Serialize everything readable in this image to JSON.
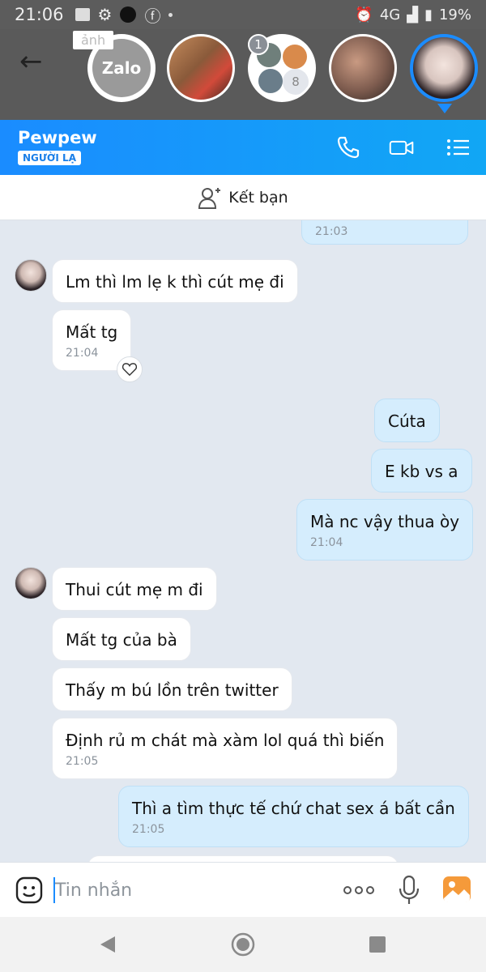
{
  "status_bar": {
    "time": "21:06",
    "network": "4G",
    "battery": "19%"
  },
  "chat_heads": {
    "zalo_label": "Zalo",
    "obscured_label": "ảnh",
    "group_badge": "1",
    "group_member_count": "8"
  },
  "header": {
    "contact_name": "Pewpew",
    "stranger_badge": "NGƯỜI LẠ"
  },
  "add_friend": {
    "label": "Kết bạn"
  },
  "messages": [
    {
      "side": "out",
      "text": "",
      "time": "21:03"
    },
    {
      "side": "in",
      "text": "Lm thì lm lẹ k thì cút mẹ đi",
      "time": ""
    },
    {
      "side": "in",
      "text": "Mất tg",
      "time": "21:04"
    },
    {
      "side": "out",
      "text": "Cúta",
      "time": ""
    },
    {
      "side": "out",
      "text": "E kb vs a",
      "time": ""
    },
    {
      "side": "out",
      "text": "Mà nc vậy thua òy",
      "time": "21:04"
    },
    {
      "side": "in",
      "text": "Thui cút mẹ m đi",
      "time": ""
    },
    {
      "side": "in",
      "text": "Mất tg của bà",
      "time": ""
    },
    {
      "side": "in",
      "text": "Thấy m bú lồn trên twitter",
      "time": ""
    },
    {
      "side": "in",
      "text": "Định rủ m chát mà xàm lol quá thì biến",
      "time": "21:05"
    },
    {
      "side": "out",
      "text": "Thì a tìm thực tế chứ chat sex á bất cần",
      "time": "21:05"
    }
  ],
  "input": {
    "placeholder": "Tin nhắn"
  },
  "colors": {
    "header_blue": "#1a8cff",
    "outgoing_bubble": "#d5edfd",
    "incoming_bubble": "#ffffff",
    "chat_background": "#e2e8f0"
  }
}
